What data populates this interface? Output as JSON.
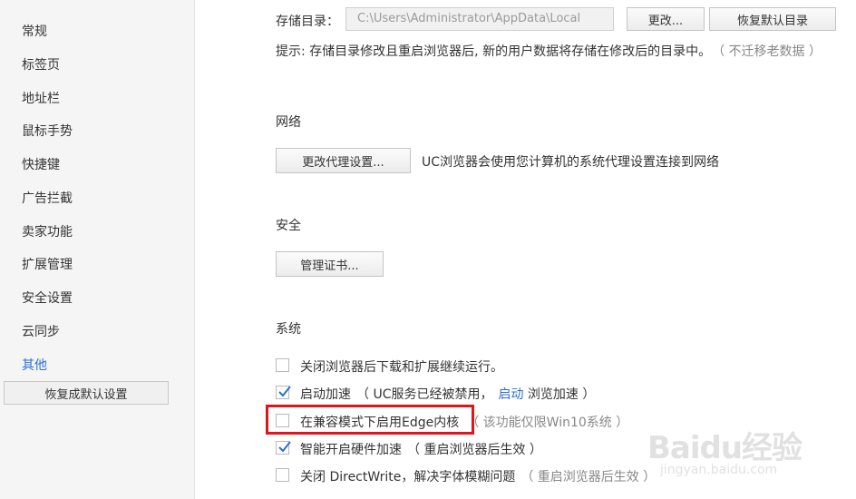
{
  "sidebar": {
    "items": [
      {
        "label": "常规"
      },
      {
        "label": "标签页"
      },
      {
        "label": "地址栏"
      },
      {
        "label": "鼠标手势"
      },
      {
        "label": "快捷键"
      },
      {
        "label": "广告拦截"
      },
      {
        "label": "卖家功能"
      },
      {
        "label": "扩展管理"
      },
      {
        "label": "安全设置"
      },
      {
        "label": "云同步"
      },
      {
        "label": "其他",
        "active": true
      }
    ],
    "reset_label": "恢复成默认设置"
  },
  "storage": {
    "label": "存储目录：",
    "path": "C:\\Users\\Administrator\\AppData\\Local",
    "change_label": "更改...",
    "restore_label": "恢复默认目录",
    "hint": "提示: 存储目录修改且重启浏览器后, 新的用户数据将存储在修改后的目录中。",
    "hint_note": "（ 不迁移老数据 ）"
  },
  "network": {
    "title": "网络",
    "proxy_label": "更改代理设置...",
    "proxy_desc": "UC浏览器会使用您计算机的系统代理设置连接到网络"
  },
  "security": {
    "title": "安全",
    "cert_label": "管理证书..."
  },
  "system": {
    "title": "系统",
    "options": {
      "bg_run": {
        "label": "关闭浏览器后下载和扩展继续运行。",
        "checked": false
      },
      "boost": {
        "label": "启动加速",
        "note_a": "（ UC服务已经被禁用，",
        "link": "启动",
        "note_b": " 浏览加速 ）",
        "checked": true
      },
      "edge": {
        "label": "在兼容模式下启用Edge内核",
        "note": "（ 该功能仅限Win10系统 ）",
        "checked": false
      },
      "hw": {
        "label": "智能开启硬件加速",
        "note": "（ 重启浏览器后生效 ）",
        "checked": true
      },
      "dwrite": {
        "label": "关闭 DirectWrite，解决字体模糊问题",
        "note": "（ 重启浏览器后生效 ）",
        "checked": false
      }
    }
  },
  "watermark": {
    "logo": "Baidu经验",
    "url": "jingyan.baidu.com"
  },
  "colors": {
    "accent": "#2a6fd4",
    "highlight": "#e0151b"
  }
}
